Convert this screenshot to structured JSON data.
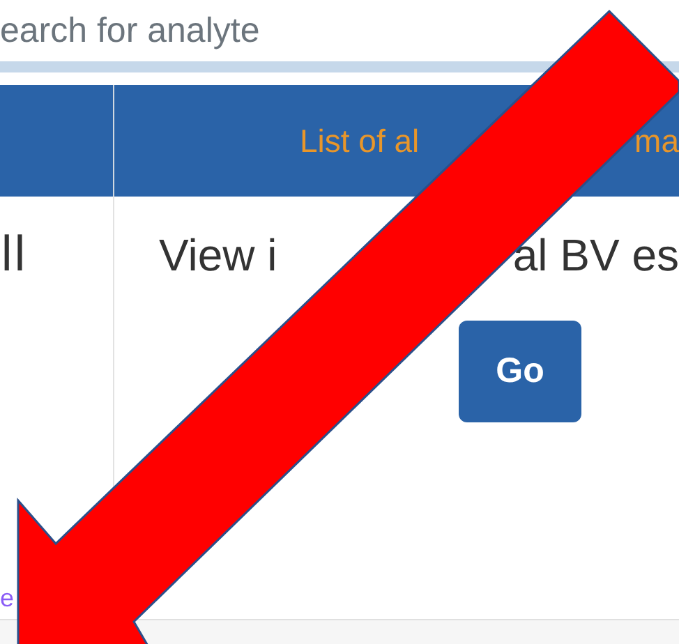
{
  "search_field": {
    "placeholder": "earch for analyte"
  },
  "table": {
    "header": {
      "column_2_parts": [
        "List of al",
        "ma"
      ]
    },
    "row": {
      "column_1": "ll",
      "column_2_parts": [
        "View i",
        "al BV es"
      ],
      "button": "Go"
    }
  },
  "footer_link": "e"
}
